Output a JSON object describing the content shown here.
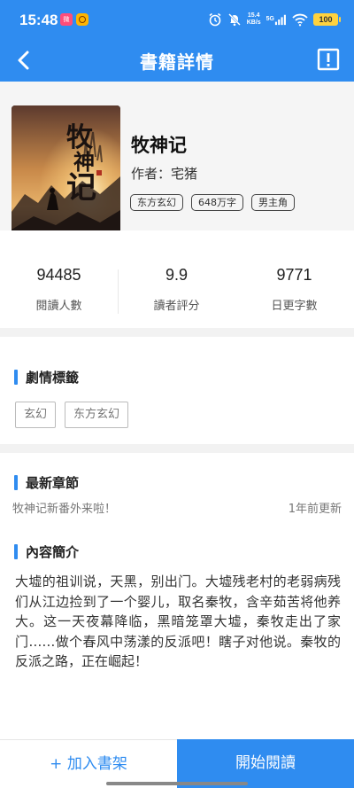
{
  "status": {
    "time": "15:48",
    "app_icon_1": "weibo-app-icon",
    "app_icon_2": "app-icon",
    "speed_value": "15.4",
    "speed_unit": "KB/s",
    "network": "5G",
    "battery": "100"
  },
  "nav": {
    "back_icon": "back-arrow-icon",
    "title": "書籍詳情",
    "report_icon": "report-icon"
  },
  "book": {
    "title": "牧神记",
    "author_label": "作者：",
    "author": "宅猪",
    "tags": [
      "东方玄幻",
      "648万字",
      "男主角"
    ],
    "cover_calligraphy": "牧神记"
  },
  "stats": [
    {
      "value": "94485",
      "label": "閱讀人數"
    },
    {
      "value": "9.9",
      "label": "讀者評分"
    },
    {
      "value": "9771",
      "label": "日更字數"
    }
  ],
  "plot": {
    "title": "劇情標籤",
    "tags": [
      "玄幻",
      "东方玄幻"
    ]
  },
  "latest": {
    "title": "最新章節",
    "chapter": "牧神记新番外来啦！",
    "time": "1年前更新"
  },
  "intro": {
    "title": "內容簡介",
    "text": "大墟的祖训说，天黑，别出门。大墟残老村的老弱病残们从江边捡到了一个婴儿，取名秦牧，含辛茹苦将他养大。这一天夜幕降临，黑暗笼罩大墟，秦牧走出了家门……做个春风中荡漾的反派吧！瞎子对他说。秦牧的反派之路，正在崛起！"
  },
  "actions": {
    "add_shelf": "+ 加入書架",
    "start_read": "開始閱讀"
  },
  "colors": {
    "accent": "#2f8cf0",
    "background": "#f2f2f2"
  }
}
